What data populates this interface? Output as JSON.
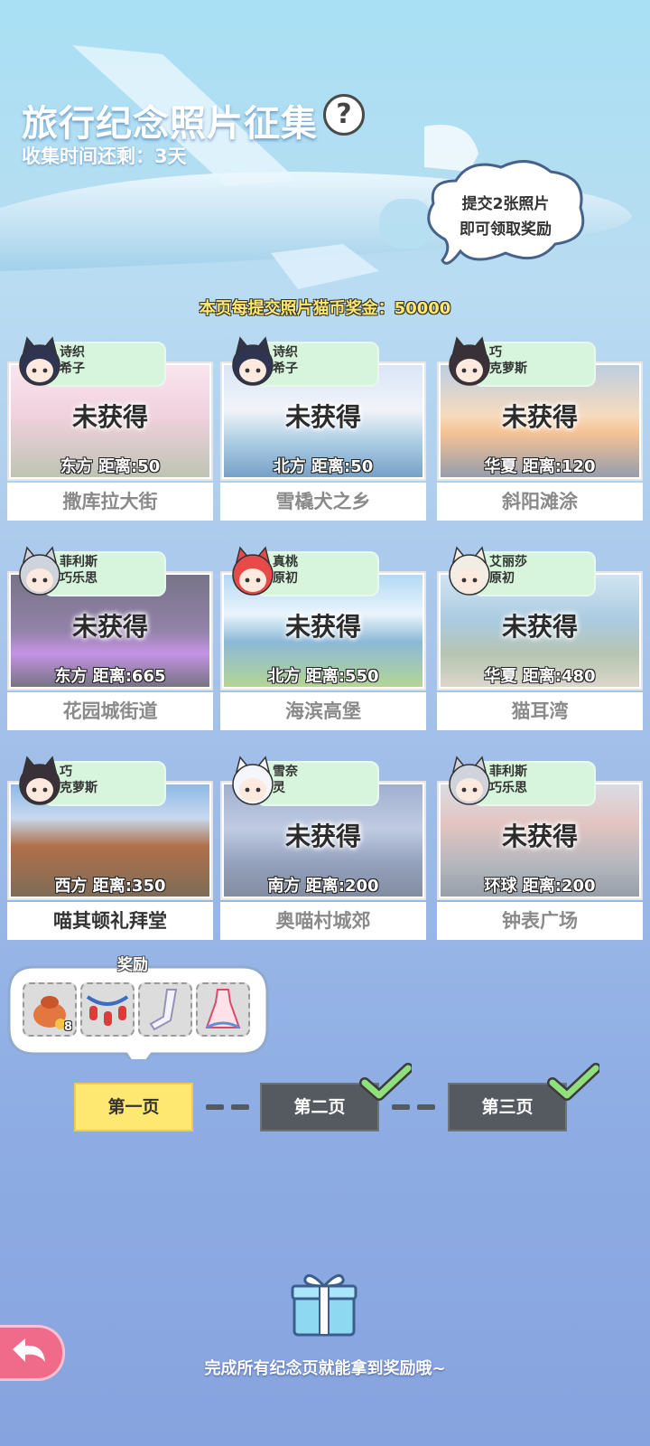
{
  "header": {
    "title": "旅行纪念照片征集",
    "help_symbol": "?",
    "time_left": "收集时间还剩：3天"
  },
  "cloud_tip": {
    "line1": "提交2张照片",
    "line2": "即可领取奖励"
  },
  "coin_bonus": "本页每提交照片猫币奖金：50000",
  "cards": [
    {
      "character_line1": "诗织",
      "character_line2": "希子",
      "status": "未获得",
      "direction_distance": "东方  距离:50",
      "place": "撒库拉大街"
    },
    {
      "character_line1": "诗织",
      "character_line2": "希子",
      "status": "未获得",
      "direction_distance": "北方  距离:50",
      "place": "雪橇犬之乡"
    },
    {
      "character_line1": "巧",
      "character_line2": "克萝斯",
      "status": "未获得",
      "direction_distance": "华夏  距离:120",
      "place": "斜阳滩涂"
    },
    {
      "character_line1": "菲利斯",
      "character_line2": "巧乐思",
      "status": "未获得",
      "direction_distance": "东方  距离:665",
      "place": "花园城街道"
    },
    {
      "character_line1": "真桃",
      "character_line2": "原初",
      "status": "未获得",
      "direction_distance": "北方  距离:550",
      "place": "海滨高堡"
    },
    {
      "character_line1": "艾丽莎",
      "character_line2": "原初",
      "status": "未获得",
      "direction_distance": "华夏  距离:480",
      "place": "猫耳湾"
    },
    {
      "character_line1": "巧",
      "character_line2": "克萝斯",
      "status": "",
      "direction_distance": "西方  距离:350",
      "place": "喵其顿礼拜堂"
    },
    {
      "character_line1": "雪奈",
      "character_line2": "灵",
      "status": "未获得",
      "direction_distance": "南方  距离:200",
      "place": "奥喵村城郊"
    },
    {
      "character_line1": "菲利斯",
      "character_line2": "巧乐思",
      "status": "未获得",
      "direction_distance": "环球  距离:200",
      "place": "钟表广场"
    }
  ],
  "reward": {
    "label": "奖励",
    "items": [
      {
        "icon": "cat-coin-bag-icon",
        "count": "8"
      },
      {
        "icon": "lantern-garland-icon",
        "count": ""
      },
      {
        "icon": "stockings-icon",
        "count": ""
      },
      {
        "icon": "dress-icon",
        "count": ""
      }
    ]
  },
  "pages": [
    {
      "label": "第一页",
      "state": "active"
    },
    {
      "label": "第二页",
      "state": "done"
    },
    {
      "label": "第三页",
      "state": "done"
    }
  ],
  "final_reward_text": "完成所有纪念页就能拿到奖励哦~",
  "back_icon": "back-arrow-icon",
  "colors": {
    "active_tab": "#ffe872",
    "done_tab": "#555a60",
    "check": "#8fe07a",
    "chip": "#d7f5dc",
    "back_button": "#f06b8a"
  }
}
